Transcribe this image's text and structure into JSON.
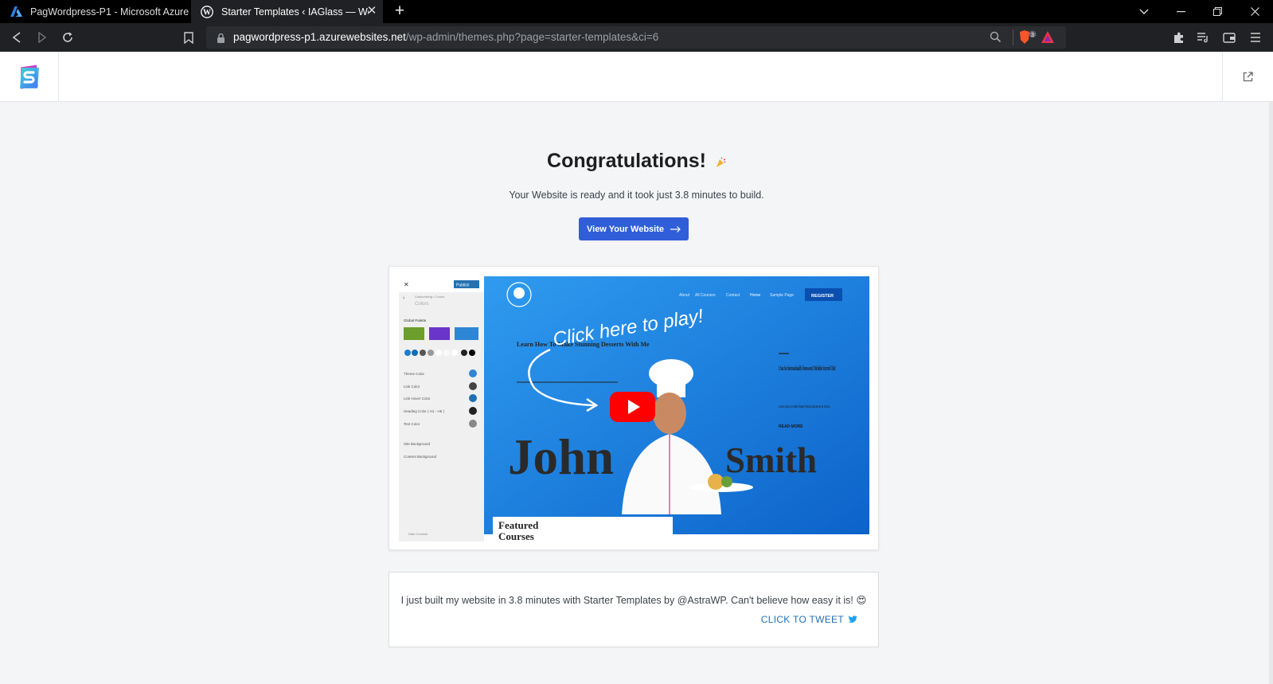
{
  "browser": {
    "tabs": [
      {
        "title": "PagWordpress-P1 - Microsoft Azure",
        "icon": "azure-icon"
      },
      {
        "title": "Starter Templates ‹ IAGlass — Wo",
        "icon": "wordpress-icon"
      }
    ],
    "url_host": "pagwordpress-p1.azurewebsites.net",
    "url_path": "/wp-admin/themes.php?page=starter-templates&ci=6",
    "brave_badge": "3"
  },
  "main": {
    "title": "Congratulations!",
    "subtitle": "Your Website is ready and it took just 3.8 minutes to build.",
    "view_button": "View Your Website"
  },
  "video": {
    "overlay_text": "Click here to play!",
    "sidebar_header": "Customizing • Colors",
    "sidebar_section": "Colors",
    "publish": "Publish",
    "global_palette": "Global Palette",
    "settings": [
      "Theme Color",
      "Link Color",
      "Link Hover Color",
      "Heading Color ( H1 - H6 )",
      "Text Color"
    ],
    "backgrounds": [
      "Site Background",
      "Content Background"
    ],
    "hide_controls": "Hide Controls",
    "nav_items": [
      "About",
      "All Courses",
      "Contact",
      "Home",
      "Sample Page"
    ],
    "register": "REGISTER",
    "learn_text": "Learn How To Make Stunning Desserts With Me",
    "first_name": "John",
    "last_name": "Smith",
    "bio_heading": "I Am An Internationally Renowned, Michelin Starred Chef.",
    "bio_text": "Learn how to make finger licking desserts at home.",
    "read_more": "READ MORE",
    "featured": "Featured",
    "featured_2": "Courses"
  },
  "tweet": {
    "text": "I just built my website in 3.8 minutes with Starter Templates by @AstraWP. Can't believe how easy it is! 😍",
    "link": "CLICK TO TWEET"
  },
  "colors": {
    "accent": "#2f5ed8",
    "video_bg": "#1e90e8"
  }
}
